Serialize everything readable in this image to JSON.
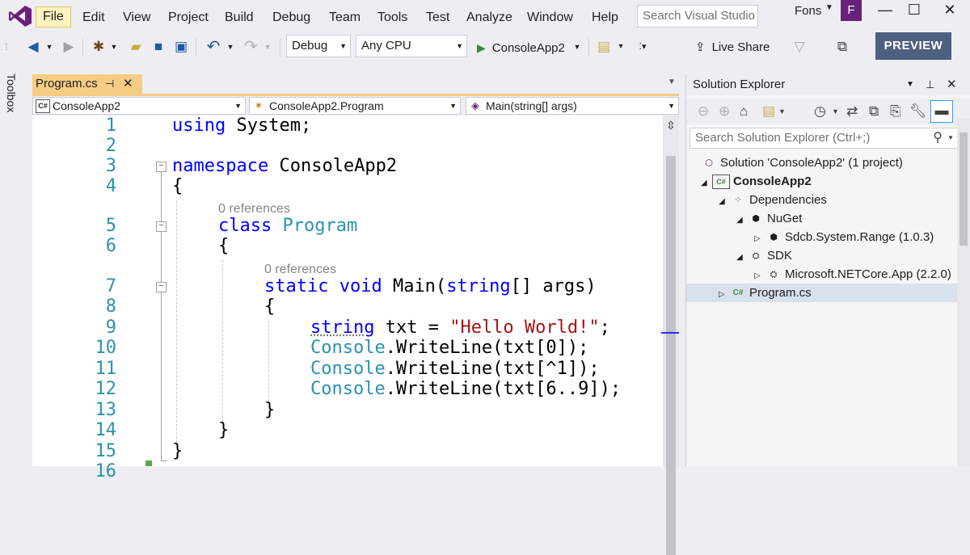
{
  "menu": [
    "File",
    "Edit",
    "View",
    "Project",
    "Build",
    "Debug",
    "Team",
    "Tools",
    "Test",
    "Analyze",
    "Window",
    "Help"
  ],
  "search": {
    "placeholder": "Search Visual Studio ("
  },
  "user": {
    "name": "Fons",
    "initial": "F"
  },
  "window_buttons": {
    "minimize": "—",
    "maximize": "☐",
    "close": "✕"
  },
  "toolbar": {
    "configuration": "Debug",
    "platform": "Any CPU",
    "start_target": "ConsoleApp2",
    "live_share": "Live Share",
    "preview": "PREVIEW"
  },
  "toolbox_label": "Toolbox",
  "document_tab": {
    "name": "Program.cs",
    "pin": "⊣",
    "close": "✕"
  },
  "navbar": {
    "project": "ConsoleApp2",
    "type": "ConsoleApp2.Program",
    "member": "Main(string[] args)"
  },
  "editor": {
    "line_numbers": [
      "1",
      "2",
      "3",
      "4",
      "5",
      "6",
      "7",
      "8",
      "9",
      "10",
      "11",
      "12",
      "13",
      "14",
      "15",
      "16"
    ],
    "codelens": "0 references",
    "lines": {
      "l1_kw": "using",
      "l1_rest": " System;",
      "l3_kw": "namespace",
      "l3_rest": " ConsoleApp2",
      "l4": "{",
      "l5_kw": "class",
      "l5_type": "Program",
      "l6": "{",
      "l7_kw": "static void",
      "l7_name": " Main(",
      "l7_kw2": "string",
      "l7_rest": "[] args)",
      "l8": "{",
      "l9_kw": "string",
      "l9_mid": " txt = ",
      "l9_str": "\"Hello World!\"",
      "l9_end": ";",
      "l10_type": "Console",
      "l10_rest": ".WriteLine(txt[0]);",
      "l11_type": "Console",
      "l11_rest": ".WriteLine(txt[^1]);",
      "l12_type": "Console",
      "l12_rest": ".WriteLine(txt[6..9]);",
      "l13": "}",
      "l14": "}",
      "l15": "}"
    },
    "colors": {
      "keyword": "#0000ff",
      "type": "#2b91af",
      "string": "#a31515",
      "line_number": "#2b91af"
    }
  },
  "solution_explorer": {
    "title": "Solution Explorer",
    "search_placeholder": "Search Solution Explorer (Ctrl+;)",
    "tree": [
      {
        "label": "Solution 'ConsoleApp2' (1 project)",
        "icon": "solution-icon"
      },
      {
        "label": "ConsoleApp2",
        "icon": "csharp-project-icon"
      },
      {
        "label": "Dependencies",
        "icon": "dependencies-icon"
      },
      {
        "label": "NuGet",
        "icon": "nuget-icon"
      },
      {
        "label": "Sdcb.System.Range (1.0.3)",
        "icon": "package-icon"
      },
      {
        "label": "SDK",
        "icon": "sdk-icon"
      },
      {
        "label": "Microsoft.NETCore.App (2.2.0)",
        "icon": "sdk-package-icon"
      },
      {
        "label": "Program.cs",
        "icon": "csharp-file-icon"
      }
    ]
  }
}
